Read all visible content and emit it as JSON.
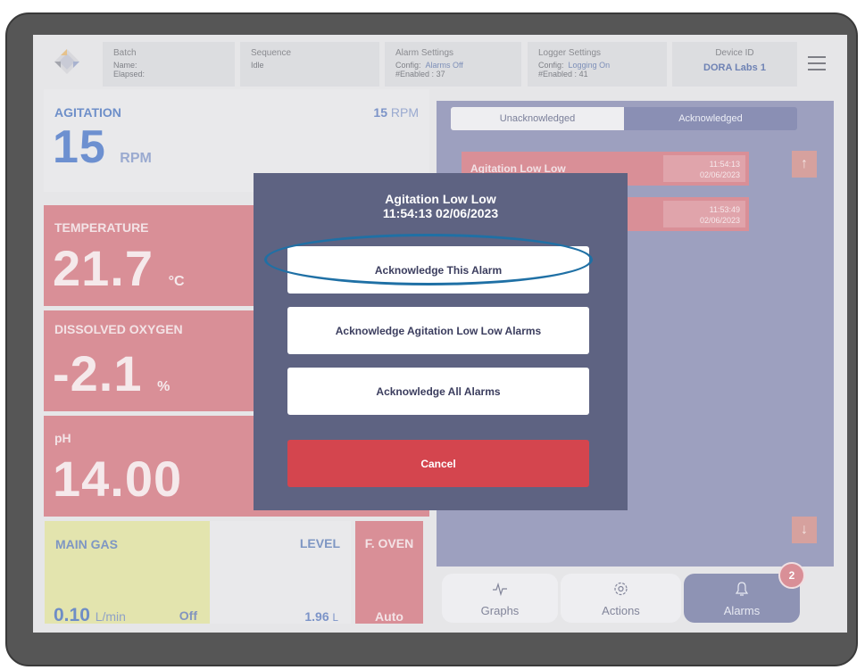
{
  "header": {
    "batch": {
      "title": "Batch",
      "name_label": "Name:",
      "elapsed_label": "Elapsed:"
    },
    "sequence": {
      "title": "Sequence",
      "value": "Idle"
    },
    "alarm_settings": {
      "title": "Alarm Settings",
      "config_label": "Config:",
      "config_value": "Alarms Off",
      "enabled_label": "#Enabled :",
      "enabled_value": "37"
    },
    "logger_settings": {
      "title": "Logger Settings",
      "config_label": "Config:",
      "config_value": "Logging On",
      "enabled_label": "#Enabled :",
      "enabled_value": "41"
    },
    "device": {
      "title": "Device ID",
      "value": "DORA Labs 1"
    }
  },
  "tiles": {
    "agitation": {
      "label": "AGITATION",
      "setpoint": "15",
      "setpoint_unit": "RPM",
      "value": "15",
      "unit": "RPM"
    },
    "temperature": {
      "label": "TEMPERATURE",
      "value": "21.7",
      "unit": "°C"
    },
    "dissolved_oxygen": {
      "label": "DISSOLVED OXYGEN",
      "value": "-2.1",
      "unit": "%"
    },
    "ph": {
      "label": "pH",
      "value": "14.00"
    },
    "main_gas": {
      "label": "MAIN GAS",
      "value": "0.10",
      "unit": "L/min",
      "state": "Off"
    },
    "level": {
      "label": "LEVEL",
      "value": "1.96",
      "unit": "L"
    },
    "f_oven": {
      "label": "F. OVEN",
      "state": "Auto"
    }
  },
  "alarm_panel": {
    "tabs": {
      "unack": "Unacknowledged",
      "ack": "Acknowledged"
    },
    "alarms": [
      {
        "name": "Agitation Low Low",
        "time": "11:54:13",
        "date": "02/06/2023"
      },
      {
        "name": "",
        "time": "11:53:49",
        "date": "02/06/2023"
      }
    ],
    "up_arrow": "↑",
    "down_arrow": "↓"
  },
  "nav": {
    "graphs": "Graphs",
    "actions": "Actions",
    "alarms": "Alarms",
    "badge": "2"
  },
  "dialog": {
    "title": "Agitation Low Low",
    "subtitle": "11:54:13 02/06/2023",
    "ack_this": "Acknowledge This Alarm",
    "ack_type": "Acknowledge Agitation Low Low Alarms",
    "ack_all": "Acknowledge All Alarms",
    "cancel": "Cancel"
  },
  "colors": {
    "dialog_bg": "#5e6382",
    "cancel": "#d4454e",
    "highlight_circle": "#1f70a5",
    "alarm_red": "#d98f97"
  }
}
